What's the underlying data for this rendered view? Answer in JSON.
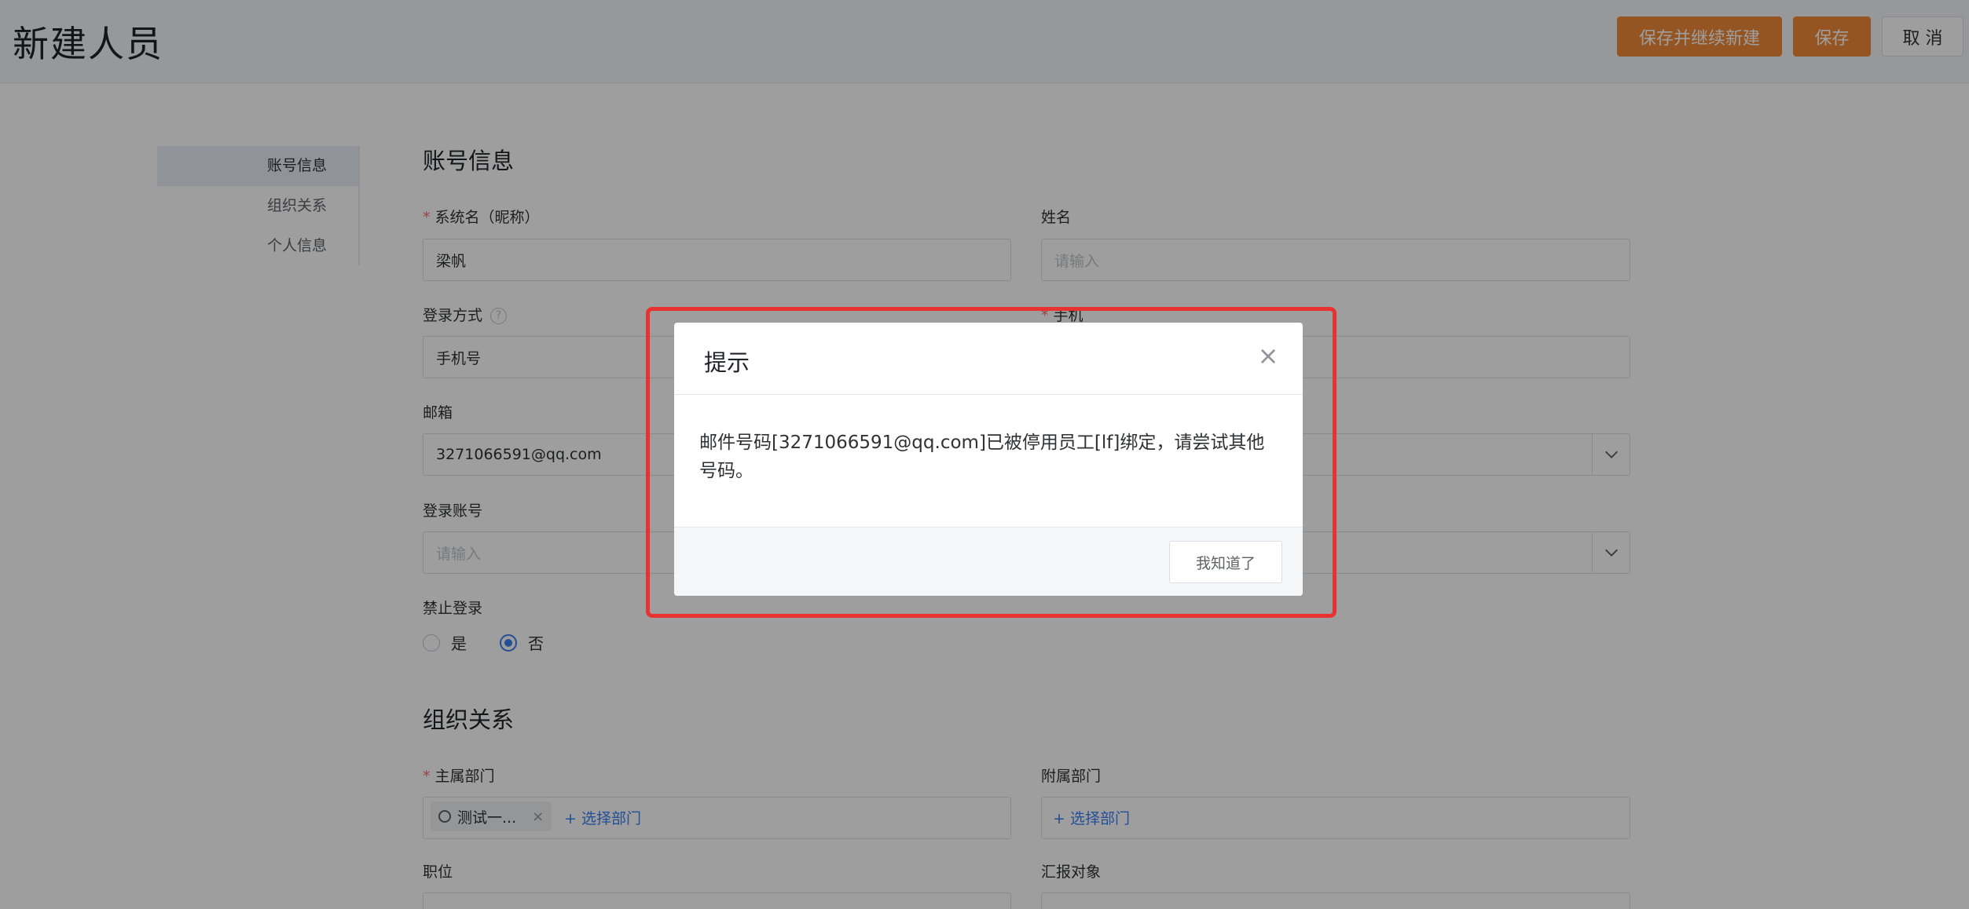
{
  "header": {
    "title": "新建人员",
    "save_continue_label": "保存并继续新建",
    "save_label": "保存",
    "cancel_label": "取 消"
  },
  "sidenav": {
    "items": [
      {
        "label": "账号信息"
      },
      {
        "label": "组织关系"
      },
      {
        "label": "个人信息"
      }
    ]
  },
  "account": {
    "section_title": "账号信息",
    "nickname_label": "系统名（昵称）",
    "nickname_value": "梁帆",
    "name_label": "姓名",
    "name_placeholder": "请输入",
    "login_method_label": "登录方式",
    "login_method_help": "?",
    "login_method_value": "手机号",
    "phone_label": "手机",
    "email_label": "邮箱",
    "email_value": "3271066591@qq.com",
    "login_account_label": "登录账号",
    "login_account_placeholder": "请输入",
    "disable_login_label": "禁止登录",
    "radio_yes": "是",
    "radio_no": "否",
    "required_mark": "*"
  },
  "org": {
    "section_title": "组织关系",
    "main_dept_label": "主属部门",
    "main_dept_tag": "测试一...",
    "tag_close": "×",
    "select_dept_link": "+ 选择部门",
    "sub_dept_label": "附属部门",
    "sub_dept_link": "+ 选择部门",
    "position_label": "职位",
    "report_label": "汇报对象"
  },
  "dialog": {
    "title": "提示",
    "close_symbol": "×",
    "message": "邮件号码[3271066591@qq.com]已被停用员工[lf]绑定，请尝试其他号码。",
    "ok_label": "我知道了"
  },
  "colors": {
    "accent_orange": "#f08a38",
    "link_blue": "#3a7ff2",
    "highlight_red": "#e8322f"
  }
}
